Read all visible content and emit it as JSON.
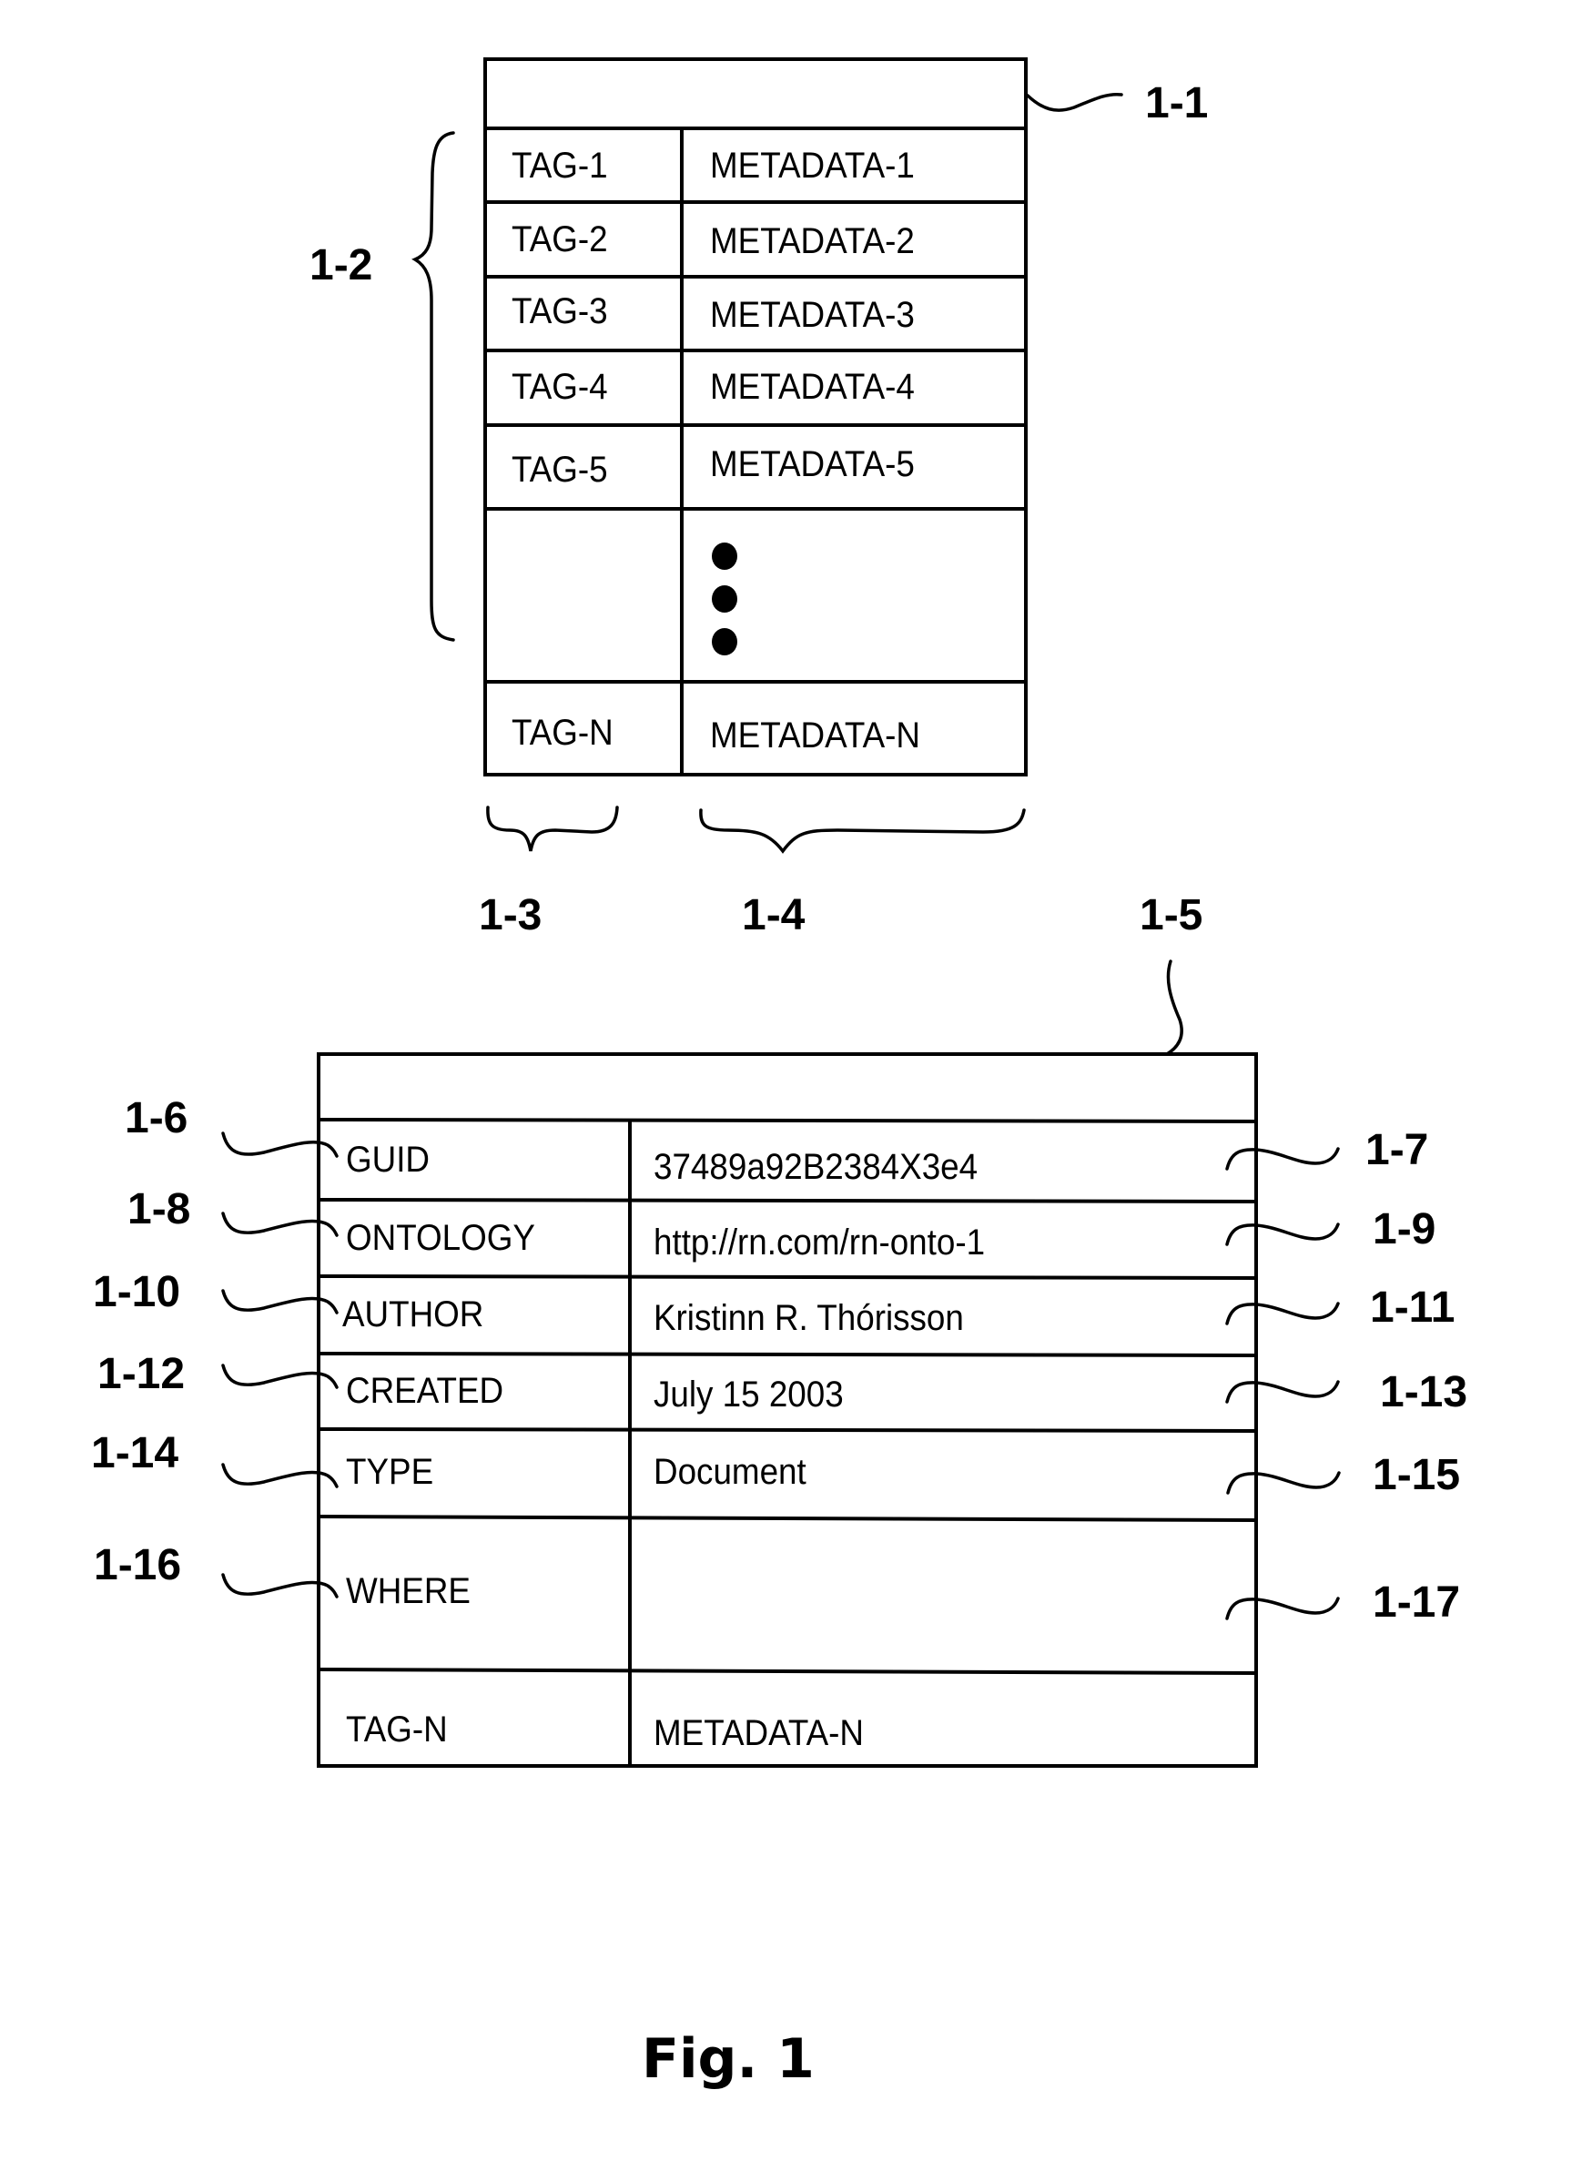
{
  "figure": {
    "caption": "Fig. 1",
    "colors": {
      "ink": "#000000",
      "paper": "#ffffff"
    }
  },
  "generic_record": {
    "ref_record": "1-1",
    "ref_tag_group": "1-2",
    "ref_tag_column": "1-3",
    "ref_metadata_column": "1-4",
    "rows": [
      {
        "tag": "TAG-1",
        "metadata": "METADATA-1"
      },
      {
        "tag": "TAG-2",
        "metadata": "METADATA-2"
      },
      {
        "tag": "TAG-3",
        "metadata": "METADATA-3"
      },
      {
        "tag": "TAG-4",
        "metadata": "METADATA-4"
      },
      {
        "tag": "TAG-5",
        "metadata": "METADATA-5"
      }
    ],
    "ellipsis": "vertical-ellipsis",
    "last_row": {
      "tag": "TAG-N",
      "metadata": "METADATA-N"
    }
  },
  "example_record": {
    "ref_record": "1-5",
    "rows": [
      {
        "tag": "GUID",
        "metadata": "37489a92B2384X3e4",
        "ref_tag": "1-6",
        "ref_metadata": "1-7"
      },
      {
        "tag": "ONTOLOGY",
        "metadata": "http://rn.com/rn-onto-1",
        "ref_tag": "1-8",
        "ref_metadata": "1-9"
      },
      {
        "tag": "AUTHOR",
        "metadata": "Kristinn R. Thórisson",
        "ref_tag": "1-10",
        "ref_metadata": "1-11"
      },
      {
        "tag": "CREATED",
        "metadata": "July 15 2003",
        "ref_tag": "1-12",
        "ref_metadata": "1-13"
      },
      {
        "tag": "TYPE",
        "metadata": "Document",
        "ref_tag": "1-14",
        "ref_metadata": "1-15"
      },
      {
        "tag": "WHERE",
        "metadata": "",
        "ref_tag": "1-16",
        "ref_metadata": "1-17"
      }
    ],
    "last_row": {
      "tag": "TAG-N",
      "metadata": "METADATA-N"
    }
  }
}
